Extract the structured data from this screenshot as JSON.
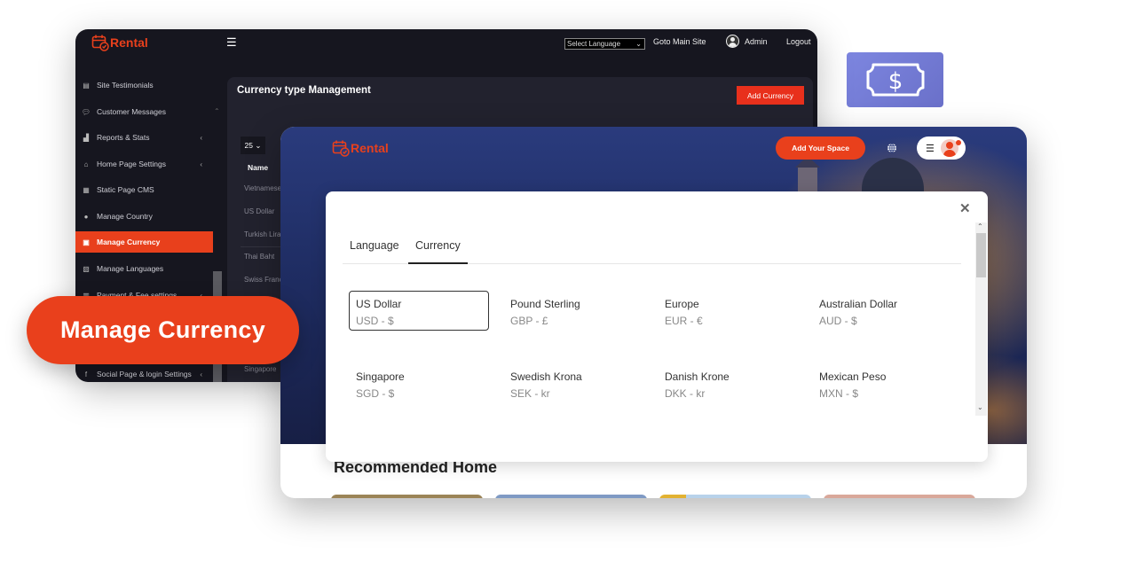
{
  "admin": {
    "brand": "Rental",
    "language_select": "Select Language",
    "goto_main_site": "Goto Main Site",
    "admin_user": "Admin",
    "logout": "Logout",
    "sidebar": [
      {
        "label": "Site Testimonials",
        "icon": "testimonials-icon",
        "has_chevron": false
      },
      {
        "label": "Customer Messages",
        "icon": "messages-icon",
        "has_chevron": false
      },
      {
        "label": "Reports & Stats",
        "icon": "chart-icon",
        "has_chevron": true
      },
      {
        "label": "Home Page Settings",
        "icon": "home-icon",
        "has_chevron": true
      },
      {
        "label": "Static Page CMS",
        "icon": "cms-icon",
        "has_chevron": false
      },
      {
        "label": "Manage Country",
        "icon": "globe-icon",
        "has_chevron": false
      },
      {
        "label": "Manage Currency",
        "icon": "money-icon",
        "has_chevron": false,
        "active": true
      },
      {
        "label": "Manage Languages",
        "icon": "language-icon",
        "has_chevron": false
      },
      {
        "label": "Payment & Fee settings",
        "icon": "payment-icon",
        "has_chevron": true
      },
      {
        "label": "Social Page & login Settings",
        "icon": "facebook-icon",
        "has_chevron": true
      }
    ],
    "panel": {
      "title": "Currency type Management",
      "add_button": "Add Currency",
      "per_page": "25",
      "column_name": "Name",
      "rows": [
        "Vietnamese",
        "US Dollar",
        "Turkish Lira",
        "Thai Baht",
        "Swiss Franc",
        "Singapore"
      ]
    }
  },
  "callout": {
    "label": "Manage Currency"
  },
  "site": {
    "brand": "Rental",
    "add_space": "Add Your Space",
    "section_title": "Recommended Home",
    "modal": {
      "tabs": [
        "Language",
        "Currency"
      ],
      "active_tab": "Currency",
      "currencies": [
        {
          "name": "US Dollar",
          "code": "USD - $",
          "selected": true
        },
        {
          "name": "Pound Sterling",
          "code": "GBP - £"
        },
        {
          "name": "Europe",
          "code": "EUR - €"
        },
        {
          "name": "Australian Dollar",
          "code": "AUD - $"
        },
        {
          "name": "Singapore",
          "code": "SGD - $"
        },
        {
          "name": "Swedish Krona",
          "code": "SEK - kr"
        },
        {
          "name": "Danish Krone",
          "code": "DKK - kr"
        },
        {
          "name": "Mexican Peso",
          "code": "MXN - $"
        }
      ]
    }
  },
  "colors": {
    "accent": "#e9401c",
    "admin_bg": "#16161f",
    "money_badge": "#737bd6"
  }
}
